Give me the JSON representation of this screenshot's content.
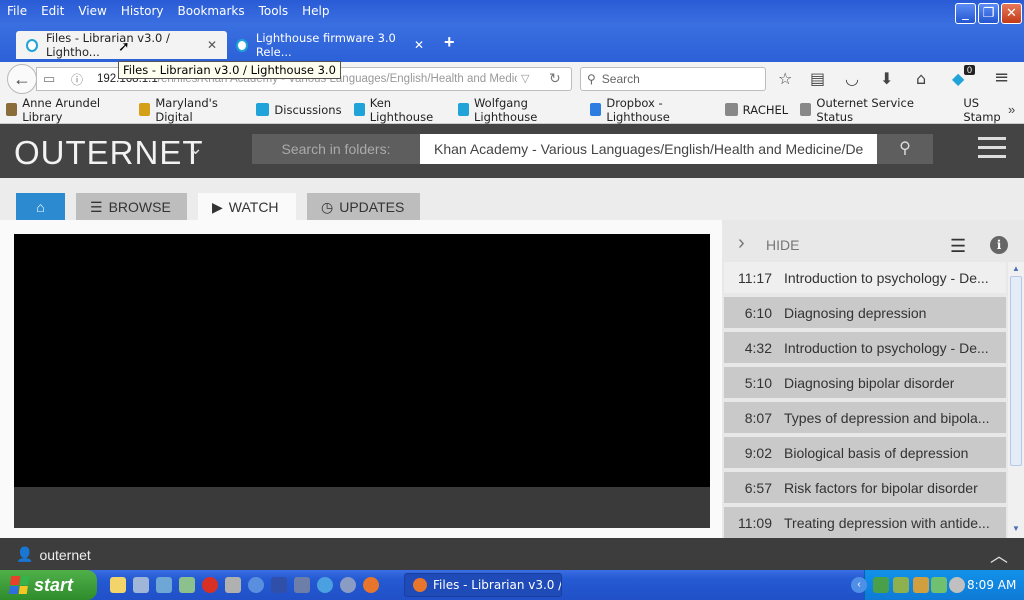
{
  "menubar": [
    "File",
    "Edit",
    "View",
    "History",
    "Bookmarks",
    "Tools",
    "Help"
  ],
  "tabs": [
    {
      "title": "Files - Librarian v3.0 / Lightho..."
    },
    {
      "title": "Lighthouse firmware 3.0 Rele..."
    }
  ],
  "tooltip": "Files - Librarian v3.0 / Lighthouse 3.0",
  "url": {
    "host": "192.168.1.1",
    "path": "/en/files/Khan Academy - Various Languages/English/Health and Medicine"
  },
  "browser_search_placeholder": "Search",
  "notification_count": "0",
  "bookmarks": [
    {
      "label": "Anne Arundel Library",
      "color": "#8a6d3b"
    },
    {
      "label": "Maryland's Digital",
      "color": "#d4a017"
    },
    {
      "label": "Discussions",
      "color": "#1fa3d8"
    },
    {
      "label": "Ken  Lighthouse",
      "color": "#1fa3d8"
    },
    {
      "label": "Wolfgang Lighthouse",
      "color": "#1fa3d8"
    },
    {
      "label": "Dropbox - Lighthouse",
      "color": "#2d7de0"
    },
    {
      "label": "RACHEL",
      "color": "#888888"
    },
    {
      "label": "Outernet Service Status",
      "color": "#888888"
    },
    {
      "label": "US Stamp",
      "color": "#f3f3f3"
    }
  ],
  "app": {
    "logo": "OUTERNET",
    "folder_label": "Search in folders:",
    "folder_value": "Khan Academy - Various Languages/English/Health and Medicine/De"
  },
  "app_tabs": {
    "browse": "BROWSE",
    "watch": "WATCH",
    "updates": "UPDATES"
  },
  "playlist": {
    "hide_label": "HIDE",
    "items": [
      {
        "duration": "11:17",
        "title": "Introduction to psychology - De..."
      },
      {
        "duration": "6:10",
        "title": "Diagnosing depression"
      },
      {
        "duration": "4:32",
        "title": "Introduction to psychology - De..."
      },
      {
        "duration": "5:10",
        "title": "Diagnosing bipolar disorder"
      },
      {
        "duration": "8:07",
        "title": "Types of depression and bipola..."
      },
      {
        "duration": "9:02",
        "title": "Biological basis of depression"
      },
      {
        "duration": "6:57",
        "title": "Risk factors for bipolar disorder"
      },
      {
        "duration": "11:09",
        "title": "Treating depression with antide..."
      }
    ]
  },
  "footer": {
    "user": "outernet"
  },
  "taskbar": {
    "start_label": "start",
    "task_title": "Files - Librarian v3.0 /...",
    "clock": "8:09 AM"
  }
}
